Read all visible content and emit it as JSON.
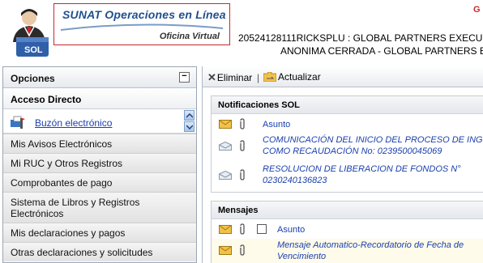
{
  "header": {
    "brand_title": "SUNAT Operaciones en Línea",
    "brand_subtitle": "Oficina Virtual",
    "logo_text": "SOL",
    "company_line1": "20524128111RICKSPLU : GLOBAL PARTNERS EXECU",
    "company_line2": "ANONIMA CERRADA - GLOBAL PARTNERS E",
    "corner_letter": "G"
  },
  "sidebar": {
    "title": "Opciones",
    "collapse_symbol": "−",
    "section": "Acceso Directo",
    "buzon_label": "Buzón electrónico",
    "items": [
      {
        "label": "Mis Avisos Electrónicos"
      },
      {
        "label": "Mi RUC y Otros Registros"
      },
      {
        "label": "Comprobantes de pago"
      },
      {
        "label": "Sistema de Libros y Registros Electrónicos"
      },
      {
        "label": "Mis declaraciones y pagos"
      },
      {
        "label": "Otras declaraciones y solicitudes"
      }
    ]
  },
  "toolbar": {
    "eliminar_label": "Eliminar",
    "separator": "|",
    "actualizar_label": "Actualizar"
  },
  "notificaciones": {
    "title": "Notificaciones SOL",
    "column_asunto": "Asunto",
    "rows": [
      {
        "line1": "COMUNICACIÓN DEL INICIO DEL PROCESO DE INGRESO",
        "line2": "COMO RECAUDACIÓN No: 0239500045069"
      },
      {
        "line1": "RESOLUCION DE LIBERACION DE FONDOS N°",
        "line2": "0230240136823"
      }
    ]
  },
  "mensajes": {
    "title": "Mensajes",
    "column_asunto": "Asunto",
    "rows": [
      {
        "line1": "Mensaje Automatico-Recordatorio de Fecha de",
        "line2": "Vencimiento"
      }
    ]
  },
  "colors": {
    "brand_blue": "#1f4f8f",
    "brand_red": "#c8282d",
    "link_blue": "#1a3fae",
    "envelope_yellow": "#f2c14a"
  }
}
